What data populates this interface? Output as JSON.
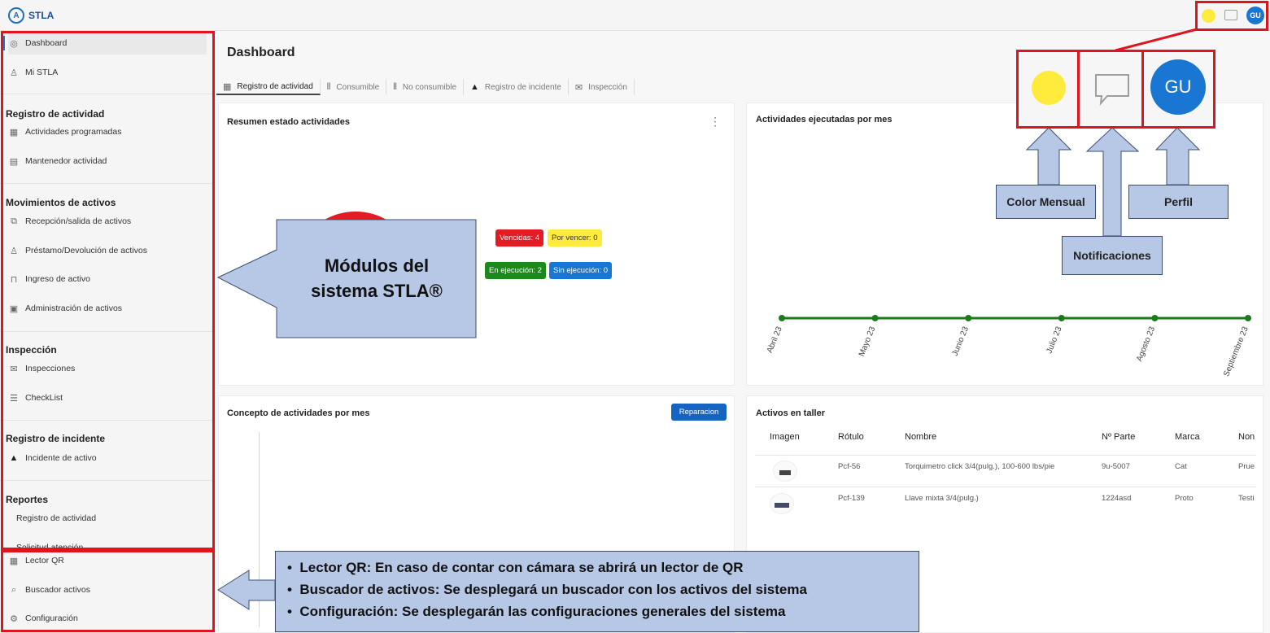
{
  "app": {
    "name": "STLA",
    "logo_letter": "A"
  },
  "topbar": {
    "avatar_initials": "GU",
    "theme_color": "#ffeb3b",
    "accent": "#1976d2"
  },
  "sidebar": {
    "dashboard": "Dashboard",
    "mi_stla": "Mi STLA",
    "sections": {
      "registro": "Registro de actividad",
      "movimientos": "Movimientos de activos",
      "inspeccion": "Inspección",
      "incidente": "Registro de incidente",
      "reportes": "Reportes"
    },
    "items": {
      "actividades_programadas": "Actividades programadas",
      "mantenedor_actividad": "Mantenedor actividad",
      "recepcion": "Recepción/salida de activos",
      "prestamo": "Préstamo/Devolución de activos",
      "ingreso": "Ingreso de activo",
      "administracion": "Administración de activos",
      "inspecciones": "Inspecciones",
      "checklist": "CheckList",
      "incidente_activo": "Incidente de activo",
      "rep_registro": "Registro de actividad",
      "rep_solicitud": "Solicitud atención",
      "lector_qr": "Lector QR",
      "buscador": "Buscador activos",
      "configuracion": "Configuración"
    }
  },
  "main": {
    "title": "Dashboard",
    "tabs": [
      "Registro de actividad",
      "Consumible",
      "No consumible",
      "Registro de incidente",
      "Inspección"
    ],
    "resumen": {
      "title": "Resumen estado actividades",
      "menu": "⋮",
      "badges": {
        "vencidas": "Vencidas: 4",
        "por_vencer": "Por vencer: 0",
        "en_ejecucion": "En ejecución: 2",
        "sin_ejecucion": "Sin ejecución: 0"
      }
    },
    "ejecutadas": {
      "title": "Actividades ejecutadas por mes"
    },
    "concepto": {
      "title": "Concepto de actividades por mes",
      "button": "Reparacion"
    },
    "taller": {
      "title": "Activos en taller",
      "headers": [
        "Imagen",
        "Rótulo",
        "Nombre",
        "Nº Parte",
        "Marca",
        "Non"
      ],
      "rows": [
        [
          "",
          "Pcf-56",
          "Torquimetro click 3/4(pulg.), 100-600 lbs/pie",
          "9u-5007",
          "Cat",
          "Prue"
        ],
        [
          "",
          "Pcf-139",
          "Llave mixta 3/4(pulg.)",
          "1224asd",
          "Proto",
          "Testi"
        ]
      ]
    }
  },
  "chart_data": [
    {
      "type": "line",
      "x": [
        "Abril 23",
        "Mayo 23",
        "Junio 23",
        "Julio 23",
        "Agosto 23",
        "Septiembre 23"
      ],
      "series": [
        {
          "values": [
            0,
            0,
            0,
            0,
            0,
            0
          ]
        }
      ],
      "color": "#1b7a1b"
    },
    {
      "type": "pie",
      "categories": [
        "En ejecución",
        "Vencidas"
      ],
      "values": [
        2,
        4
      ],
      "colors": [
        "#1b8a1b",
        "#e31b23"
      ]
    }
  ],
  "annotations": {
    "modulos": "Módulos del sistema STLA®",
    "color_mensual": "Color Mensual",
    "notificaciones": "Notificaciones",
    "perfil": "Perfil",
    "bullets": [
      "Lector QR: En caso de contar con cámara se abrirá un lector de QR",
      "Buscador de activos: Se desplegará un buscador con los activos del sistema",
      "Configuración: Se desplegarán las configuraciones generales del sistema"
    ],
    "zoom_avatar": "GU"
  }
}
